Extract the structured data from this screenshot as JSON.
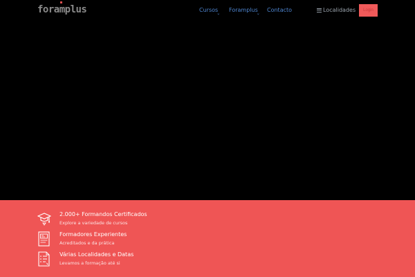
{
  "header": {
    "logo": "foramplus",
    "nav": [
      {
        "label": "Cursos"
      },
      {
        "label": "Foramplus"
      },
      {
        "label": "Contacto"
      }
    ],
    "localidades_label": "Localidades",
    "cta_label": "Login"
  },
  "features": [
    {
      "title": "2.000+ Formandos Certificados",
      "subtitle": "Explore a variedade de cursos",
      "icon": "graduation-cap-icon"
    },
    {
      "title": "Formadores Experientes",
      "subtitle": "Acreditados e da prática",
      "icon": "certificate-icon"
    },
    {
      "title": "Várias Localidades e Datas",
      "subtitle": "Levamos a formação até si",
      "icon": "document-list-icon"
    }
  ],
  "colors": {
    "band": "#ef5555",
    "nav": "#4f86d1",
    "background": "#000000"
  }
}
